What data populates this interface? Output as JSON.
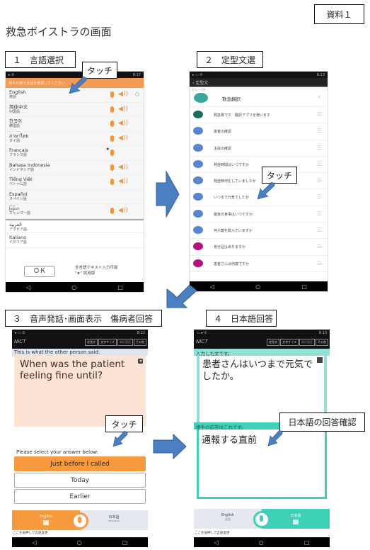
{
  "document": {
    "title": "救急ボイストラの画面",
    "reference_tag": "資料１"
  },
  "steps": [
    {
      "label": "１　言語選択"
    },
    {
      "label": "２　定型文選"
    },
    {
      "label": "３　音声発話･画面表示　傷病者回答"
    },
    {
      "label": "４　日本語回答"
    }
  ],
  "callouts": {
    "touch1": "タッチ",
    "touch2": "タッチ",
    "touch3": "タッチ",
    "confirm_jp": "日本語の回答確認"
  },
  "screen1": {
    "time": "8:17",
    "header": "相手が使う言語を選択してください",
    "languages": [
      {
        "name": "English",
        "jp": "英語",
        "mic": true,
        "speaker": true,
        "selected": true
      },
      {
        "name": "简体中文",
        "jp": "中国語",
        "mic": true,
        "speaker": true
      },
      {
        "name": "한국어",
        "jp": "韓国語",
        "mic": true,
        "speaker": true
      },
      {
        "name": "ภาษาไทย",
        "jp": "タイ語",
        "mic": true,
        "speaker": true
      },
      {
        "name": "Français",
        "jp": "フランス語",
        "mic": true,
        "speaker": false,
        "star": true
      },
      {
        "name": "Bahasa Indonesia",
        "jp": "インドネシア語",
        "mic": true,
        "speaker": true
      },
      {
        "name": "Tiếng Việt",
        "jp": "ベトナム語",
        "mic": true,
        "speaker": true
      },
      {
        "name": "Español",
        "jp": "スペイン語",
        "mic": false,
        "speaker": false
      },
      {
        "name": "မြန်မာ",
        "jp": "ミャンマー語",
        "mic": true,
        "speaker": true
      },
      {
        "name": "العربية",
        "jp": "アラビア語",
        "mic": false,
        "speaker": false
      },
      {
        "name": "Italiano",
        "jp": "イタリア語",
        "mic": false,
        "speaker": false
      }
    ],
    "ok_label": "ＯＫ",
    "note_line1": "全言語テキスト入力可能",
    "note_line2": "\"★\" 試用版"
  },
  "screen2": {
    "time": "8:13",
    "toolbar_title": "‹ 定型文",
    "group_caption": "グループ名",
    "group_name": "救急翻訳",
    "phrases": [
      {
        "text": "救急隊です　翻訳アプリを使います",
        "color": "#1e6b5f"
      },
      {
        "text": "患者の確認",
        "color": "#5a83d0"
      },
      {
        "text": "主訴の確認",
        "color": "#5a83d0"
      },
      {
        "text": "発症時間はいつですか",
        "color": "#5a83d0"
      },
      {
        "text": "発症時何をしていましたか",
        "color": "#5a83d0"
      },
      {
        "text": "いつまで元気でしたか",
        "color": "#5a83d0"
      },
      {
        "text": "最後の食事はいつですか",
        "color": "#5a83d0"
      },
      {
        "text": "何か薬を飲んでいますか",
        "color": "#5a83d0"
      },
      {
        "text": "身分証はありますか",
        "color": "#b4127f"
      },
      {
        "text": "患者さんは何歳ですか",
        "color": "#b4127f"
      }
    ]
  },
  "toolbar_buttons": [
    "定型文",
    "文字サイズ",
    "翻訳履歴",
    "その他"
  ],
  "screen3": {
    "time": "8:22",
    "said_label": "This is what the other person said:",
    "message": "When was the patient feeling fine until?",
    "prompt": "Please select your answer below:",
    "answers": [
      "Just before I called",
      "Today",
      "Earlier"
    ],
    "left_lang": "English",
    "right_lang": "日本語",
    "right_lang_sub": "Japanese",
    "hint": "ここを長押しで言語変更"
  },
  "screen4": {
    "time": "8:13",
    "input_label": "入力した文です。",
    "input_text": "患者さんはいつまで元気でしたか。",
    "response_label": "相手の応答はこれです。",
    "response_text": "通報する直前",
    "left_lang": "English",
    "left_lang_sub": "英語",
    "right_lang": "日本語",
    "hint": "ここを長押しで言語変更"
  },
  "colors": {
    "orange": "#f79a3e",
    "teal": "#3fd0b8",
    "arrow_blue": "#4a7fc1"
  }
}
